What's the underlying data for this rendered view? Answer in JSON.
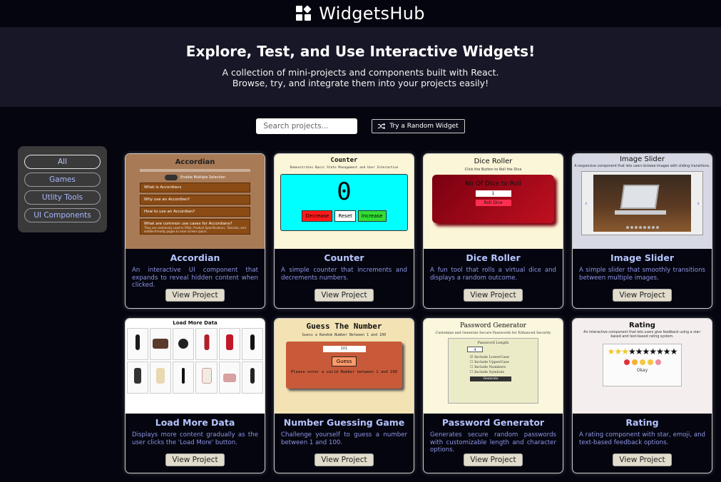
{
  "header": {
    "app_name": "WidgetsHub",
    "logo_icon": "widgets-icon"
  },
  "hero": {
    "title": "Explore, Test, and Use Interactive Widgets!",
    "line1": "A collection of mini-projects and components built with React.",
    "line2": "Browse, try, and integrate them into your projects easily!"
  },
  "toolbar": {
    "search_placeholder": "Search projects...",
    "random_label": "Try a Random Widget",
    "random_icon": "shuffle-icon"
  },
  "filters": [
    "All",
    "Games",
    "Utlity Tools",
    "UI Components"
  ],
  "active_filter": "All",
  "cards": [
    {
      "title": "Accordian",
      "desc": "An interactive UI component that expands to reveal hidden content when clicked.",
      "button": "View Project",
      "thumb": {
        "title": "Accordian",
        "toggle": "Enable Multiple Selection",
        "items": [
          "What is Accordians",
          "Why use an Accordian?",
          "How to use an Accordian?",
          "What are common use cases for Accordians?"
        ],
        "item_detail": "They are commonly used in FAQs, Product Specifications, Tutorials, and mobile-friendly pages to save screen space."
      }
    },
    {
      "title": "Counter",
      "desc": "A simple counter that increments and decrements numbers.",
      "button": "View Project",
      "thumb": {
        "title": "Counter",
        "subtitle": "Demonstrates Basic State Management and User Interaction",
        "value": "0",
        "decrease": "Decrease",
        "reset": "Reset",
        "increase": "Increase"
      }
    },
    {
      "title": "Dice Roller",
      "desc": "A fun tool that rolls a virtual dice and displays a random outcome.",
      "button": "View Project",
      "thumb": {
        "title": "Dice Roller",
        "subtitle": "Click the Button to Roll the Dice",
        "label": "No Of Dice to Roll",
        "input": "1",
        "button": "Roll Dice"
      }
    },
    {
      "title": "Image Slider",
      "desc": "A simple slider that smoothly transitions between multiple images.",
      "button": "View Project",
      "thumb": {
        "title": "Image Slider",
        "subtitle": "A responsive component that lets users browse images with sliding transitions."
      }
    },
    {
      "title": "Load More Data",
      "desc": "Displays more content gradually as the user clicks the 'Load More' button.",
      "button": "View Project",
      "thumb": {
        "title": "Load More Data"
      }
    },
    {
      "title": "Number Guessing Game",
      "desc": "Challenge yourself to guess a number between 1 and 100.",
      "button": "View Project",
      "thumb": {
        "title": "Guess The Number",
        "subtitle": "Guess a Random Number Between 1 and 100",
        "input": "101",
        "button": "Guess",
        "message": "Please enter a valid Number between 1 and 100"
      }
    },
    {
      "title": "Password Generator",
      "desc": "Generates secure random passwords with customizable length and character options.",
      "button": "View Project",
      "thumb": {
        "title": "Password Generator",
        "subtitle": "Customize and Generate Secure Passwords for Enhanced Security",
        "label": "Password Length",
        "input": "4",
        "options": [
          "Include LowerCase",
          "Include UpperCase",
          "Include Numbers",
          "Include Symbols"
        ],
        "button": "Generate"
      }
    },
    {
      "title": "Rating",
      "desc": "A rating component with star, emoji, and text-based feedback options.",
      "button": "View Project",
      "thumb": {
        "title": "Rating",
        "subtitle": "An interactive component that lets users give feedback using a star-based and text-based rating system.",
        "text": "Okay",
        "stars_filled": 3,
        "stars_total": 10
      }
    }
  ]
}
